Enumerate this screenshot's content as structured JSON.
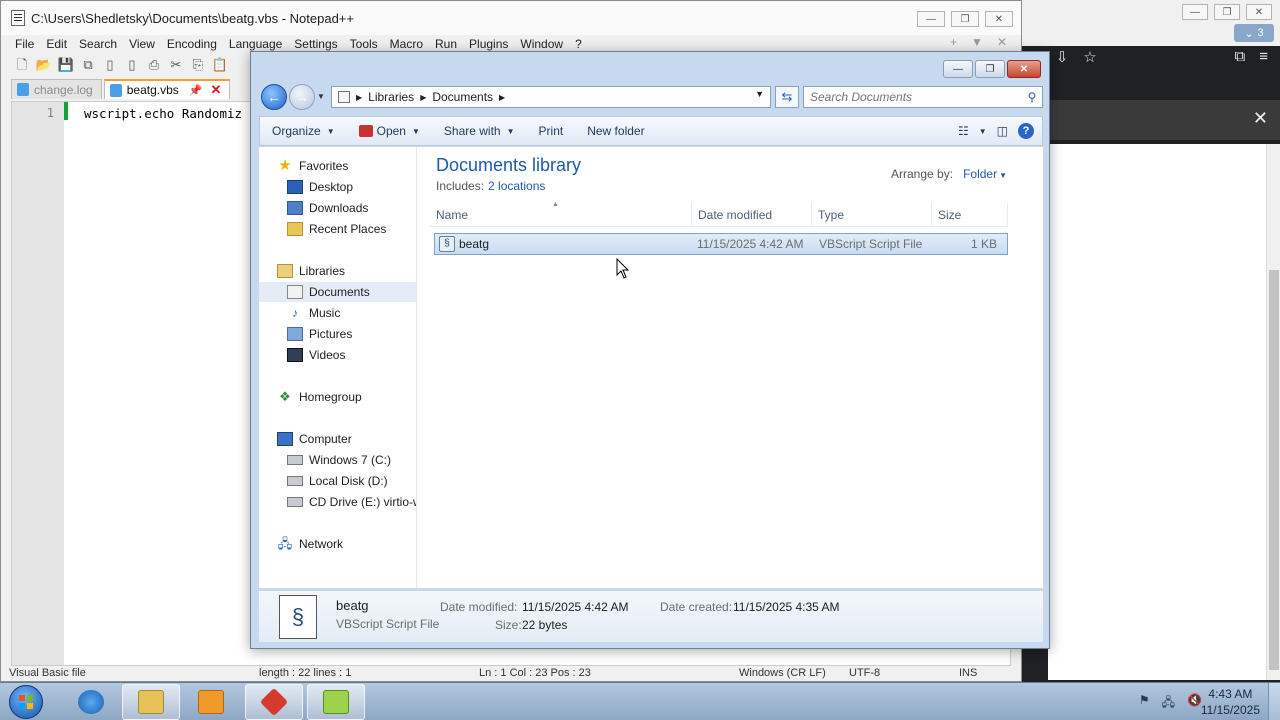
{
  "browser": {
    "tab_count": "3"
  },
  "notepad": {
    "title": "C:\\Users\\Shedletsky\\Documents\\beatg.vbs - Notepad++",
    "menu": [
      "File",
      "Edit",
      "Search",
      "View",
      "Encoding",
      "Language",
      "Settings",
      "Tools",
      "Macro",
      "Run",
      "Plugins",
      "Window",
      "?"
    ],
    "menu_right": [
      "+",
      "▼",
      "✕"
    ],
    "tabs": [
      {
        "label": "change.log",
        "active": false
      },
      {
        "label": "beatg.vbs",
        "active": true
      }
    ],
    "line_number": "1",
    "code_line": "wscript.echo Randomiz",
    "status": [
      "Visual Basic file",
      "length : 22    lines : 1",
      "Ln : 1    Col : 23    Pos : 23",
      "Windows (CR LF)",
      "UTF-8",
      "INS"
    ]
  },
  "explorer": {
    "address": {
      "segments": [
        "Libraries",
        "Documents"
      ]
    },
    "search": {
      "placeholder": "Search Documents"
    },
    "commands": {
      "organize": "Organize",
      "open": "Open",
      "share_with": "Share with",
      "print": "Print",
      "new_folder": "New folder"
    },
    "nav": {
      "favorites": "Favorites",
      "desktop": "Desktop",
      "downloads": "Downloads",
      "recent_places": "Recent Places",
      "libraries": "Libraries",
      "documents": "Documents",
      "music": "Music",
      "pictures": "Pictures",
      "videos": "Videos",
      "homegroup": "Homegroup",
      "computer": "Computer",
      "drive_c": "Windows 7 (C:)",
      "drive_d": "Local Disk (D:)",
      "drive_e": "CD Drive (E:) virtio-w",
      "network": "Network"
    },
    "library": {
      "title": "Documents library",
      "includes_label": "Includes:",
      "includes_link": "2 locations",
      "arrange_label": "Arrange by:",
      "arrange_value": "Folder"
    },
    "columns": {
      "name": "Name",
      "date": "Date modified",
      "type": "Type",
      "size": "Size"
    },
    "files": [
      {
        "name": "beatg",
        "date": "11/15/2025 4:42 AM",
        "type": "VBScript Script File",
        "size": "1 KB"
      }
    ],
    "details": {
      "name": "beatg",
      "type": "VBScript Script File",
      "date_modified_label": "Date modified:",
      "date_modified": "11/15/2025 4:42 AM",
      "date_created_label": "Date created:",
      "date_created": "11/15/2025 4:35 AM",
      "size_label": "Size:",
      "size": "22 bytes"
    }
  },
  "taskbar": {
    "time": "4:43 AM",
    "date": "11/15/2025"
  },
  "colors": {
    "link_blue": "#1e5aa8",
    "selection": "#c9dcf1",
    "taskbar": "#8ea7c4"
  }
}
